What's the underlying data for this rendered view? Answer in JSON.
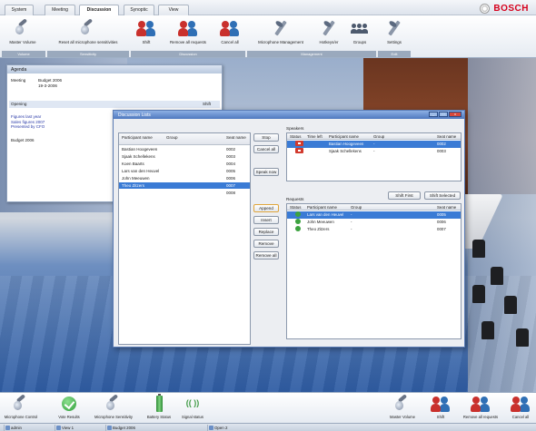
{
  "brand": {
    "name": "BOSCH"
  },
  "tabs": [
    "System",
    "Meeting",
    "Discussion",
    "Synoptic",
    "View"
  ],
  "ribbon": {
    "buttons": [
      {
        "label": "Master Volume",
        "icon": "microphone-icon"
      },
      {
        "label": "Reset all microphone sensitivities",
        "icon": "microphone-reset-icon"
      },
      {
        "label": "Shift",
        "icon": "shift-icon"
      },
      {
        "label": "Remove all requests",
        "icon": "remove-requests-icon"
      },
      {
        "label": "Cancel all",
        "icon": "cancel-all-icon"
      },
      {
        "label": "Microphone Management",
        "icon": "microphone-management-icon"
      },
      {
        "label": "Hotkeys/er",
        "icon": "hotkeys-icon"
      },
      {
        "label": "Groups",
        "icon": "groups-icon"
      },
      {
        "label": "Settings",
        "icon": "settings-icon"
      }
    ],
    "groups": [
      "Volume",
      "Sensitivity",
      "Discussion",
      "Management",
      "Edit"
    ]
  },
  "agenda": {
    "title": "Agenda",
    "meeting_label": "Meeting",
    "meeting_value": "Budget 2006",
    "meeting_date": "19-3-2006",
    "opening": "Opening",
    "shift_header": "Shift",
    "items": [
      "Figures last year",
      "Sales figures 2007",
      "Presented by CFO"
    ],
    "budget": "Budget 2006"
  },
  "discussion": {
    "title": "Discussion Lists",
    "participants_header": {
      "name": "Participant name",
      "group": "Group",
      "seat": "Seat name"
    },
    "participants": [
      {
        "name": "Bastian Hoogeveen",
        "seat": "0002"
      },
      {
        "name": "Sjaak Schellekens",
        "seat": "0003"
      },
      {
        "name": "Koen Baarts",
        "seat": "0004"
      },
      {
        "name": "Lars van den Heuvel",
        "seat": "0005"
      },
      {
        "name": "John Meeuwen",
        "seat": "0006"
      },
      {
        "name": "Theo Zitzers",
        "seat": "0007"
      },
      {
        "name": "",
        "seat": "0008"
      }
    ],
    "buttons_top": [
      "Stop",
      "Cancel all",
      "Speak now"
    ],
    "buttons_bottom": [
      "Append",
      "Insert",
      "Replace",
      "Remove",
      "Remove all"
    ],
    "speakers_label": "Speakers",
    "speakers_header": {
      "status": "Status",
      "time_left": "Time left",
      "name": "Participant name",
      "group": "Group",
      "seat": "Seat name"
    },
    "speakers": [
      {
        "name": "Bastian Hoogeveen",
        "group": "-",
        "seat": "0002"
      },
      {
        "name": "Sjaak Schellekens",
        "group": "-",
        "seat": "0003"
      }
    ],
    "shift_first": "Shift First",
    "shift_selected": "Shift Selected",
    "requests_label": "Requests",
    "requests_header": {
      "status": "Status",
      "name": "Participant name",
      "group": "Group",
      "seat": "Seat name"
    },
    "requests": [
      {
        "name": "Lars van den Heuvel",
        "group": "-",
        "seat": "0005"
      },
      {
        "name": "John Meeuwen",
        "group": "-",
        "seat": "0006"
      },
      {
        "name": "Theo Zitzers",
        "group": "-",
        "seat": "0007"
      }
    ]
  },
  "bottom_toolbar": {
    "left": [
      {
        "label": "Microphone Control",
        "icon": "microphone-icon"
      },
      {
        "label": "Vote Results",
        "icon": "check-icon"
      },
      {
        "label": "Microphone Sensitivity",
        "icon": "microphone-sensitivity-icon"
      },
      {
        "label": "Battery Status",
        "icon": "battery-icon"
      },
      {
        "label": "Signal status",
        "icon": "signal-icon"
      }
    ],
    "right": [
      {
        "label": "Master Volume",
        "icon": "master-volume-icon"
      },
      {
        "label": "Shift",
        "icon": "shift-icon"
      },
      {
        "label": "Remove all requests",
        "icon": "remove-requests-icon"
      },
      {
        "label": "Cancel all",
        "icon": "cancel-all-icon"
      }
    ]
  },
  "statusbar": [
    "admin",
    "View 1",
    "Budget 2006",
    "Open 2"
  ]
}
